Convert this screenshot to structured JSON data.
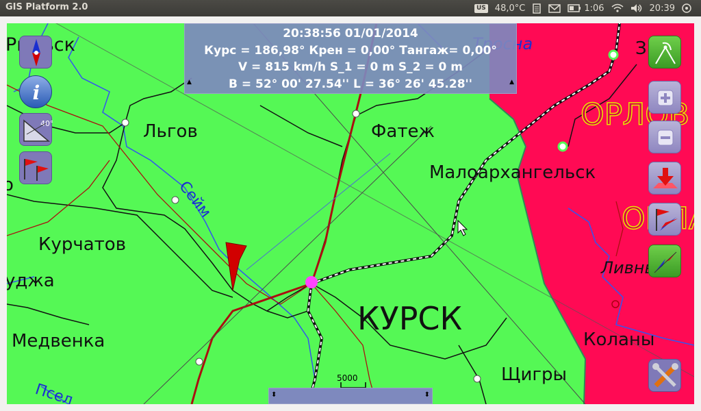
{
  "window": {
    "title": "GIS Platform 2.0"
  },
  "tray": {
    "keyboard": "US",
    "temperature": "48,0°C",
    "battery_time": "1:06",
    "clock": "20:39"
  },
  "info": {
    "line1": "20:38:56 01/01/2014",
    "line2": "Курс = 186,98° Крен = 0,00° Тангаж= 0,00°",
    "line3": "V = 815 km/h S_1 = 0 m S_2 = 0 m",
    "line4": "B = 52° 00' 27.54''  L = 36° 26' 45.28''"
  },
  "scale": {
    "label": "5000"
  },
  "map_labels": {
    "rylsk": "Рыльск",
    "lgov": "Льгов",
    "fatezh": "Фатеж",
    "maloarkh": "Малоархангельск",
    "seim": "Сейм",
    "kurchatov": "Курчатов",
    "sudzha": "уджа",
    "kursk": "КУРСК",
    "medvenka": "Медвенка",
    "kolany": "Коланы",
    "shchigry": "Щигры",
    "livny": "Ливны",
    "psel": "Псел",
    "trosna": "Тросна",
    "oryol_region": "ОРЛОВ",
    "oblast": "ОБЛА",
    "zmievka": "Зм",
    "o_left": "о"
  },
  "colors": {
    "land": "#55f855",
    "region": "#ff0a54",
    "info_panel": "#7e89be",
    "marker": "#cc0000"
  }
}
